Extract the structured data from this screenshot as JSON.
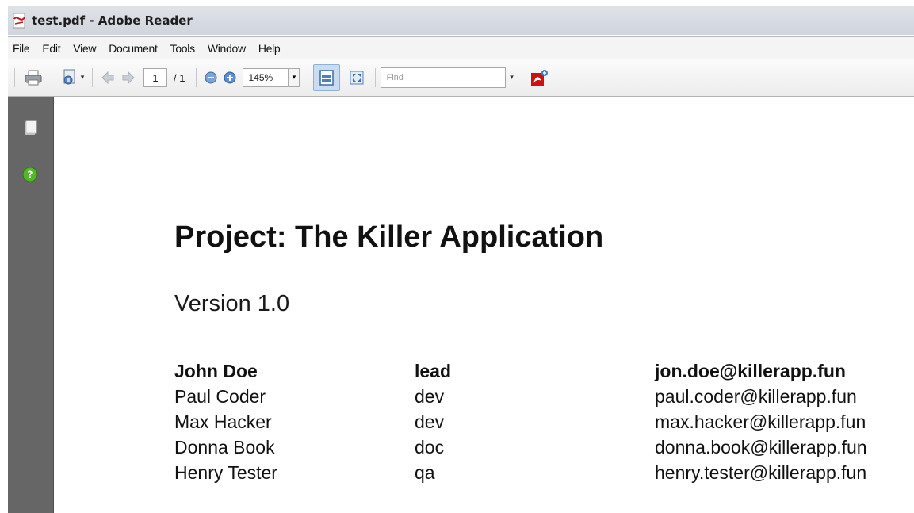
{
  "window": {
    "title": "test.pdf - Adobe Reader"
  },
  "menu": [
    "File",
    "Edit",
    "View",
    "Document",
    "Tools",
    "Window",
    "Help"
  ],
  "toolbar": {
    "page_current": "1",
    "page_total": "/ 1",
    "zoom": "145%",
    "find_placeholder": "Find"
  },
  "document": {
    "title": "Project: The Killer Application",
    "version": "Version 1.0",
    "team": [
      {
        "name": "John Doe",
        "role": "lead",
        "email": "jon.doe@killerapp.fun"
      },
      {
        "name": "Paul Coder",
        "role": "dev",
        "email": "paul.coder@killerapp.fun"
      },
      {
        "name": "Max Hacker",
        "role": "dev",
        "email": "max.hacker@killerapp.fun"
      },
      {
        "name": "Donna Book",
        "role": "doc",
        "email": "donna.book@killerapp.fun"
      },
      {
        "name": "Henry Tester",
        "role": "qa",
        "email": "henry.tester@killerapp.fun"
      }
    ]
  },
  "icons": {
    "app": "pdf-document-icon",
    "print": "printer-icon",
    "properties": "document-properties-icon",
    "prev": "previous-page-icon",
    "next": "next-page-icon",
    "zoom_out": "zoom-out-icon",
    "zoom_in": "zoom-in-icon",
    "fit_page": "fit-page-icon",
    "full_screen": "full-screen-icon",
    "acrobat": "acrobat-icon",
    "pages": "pages-panel-icon",
    "help": "help-icon"
  },
  "colors": {
    "nav_panel": "#666666",
    "acrobat_red": "#cc1111",
    "help_green": "#55b52a"
  }
}
